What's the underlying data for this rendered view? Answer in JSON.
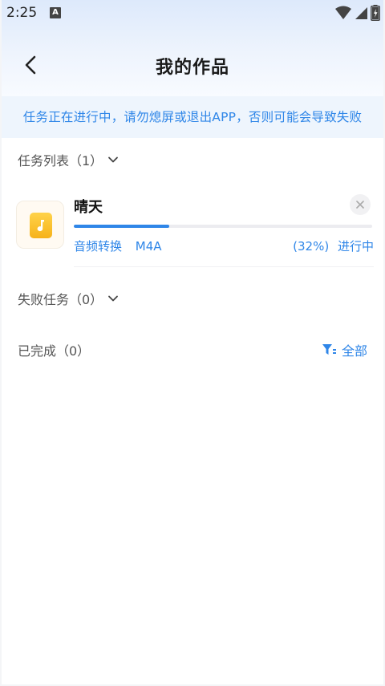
{
  "status_bar": {
    "time": "2:25",
    "notification_letter": "A"
  },
  "header": {
    "title": "我的作品"
  },
  "notice": {
    "text": "任务正在进行中，请勿熄屏或退出APP，否则可能会导致失败"
  },
  "task_list": {
    "label": "任务列表（1）",
    "tasks": [
      {
        "name": "晴天",
        "type": "音频转换",
        "format": "M4A",
        "percent_text": "(32%)",
        "progress": 0.32,
        "status": "进行中"
      }
    ]
  },
  "failed_tasks": {
    "label": "失败任务（0）"
  },
  "completed": {
    "label": "已完成（0）",
    "filter_label": "全部"
  },
  "colors": {
    "accent": "#2f86e8",
    "title": "#1a1a1a",
    "muted": "#555555"
  }
}
